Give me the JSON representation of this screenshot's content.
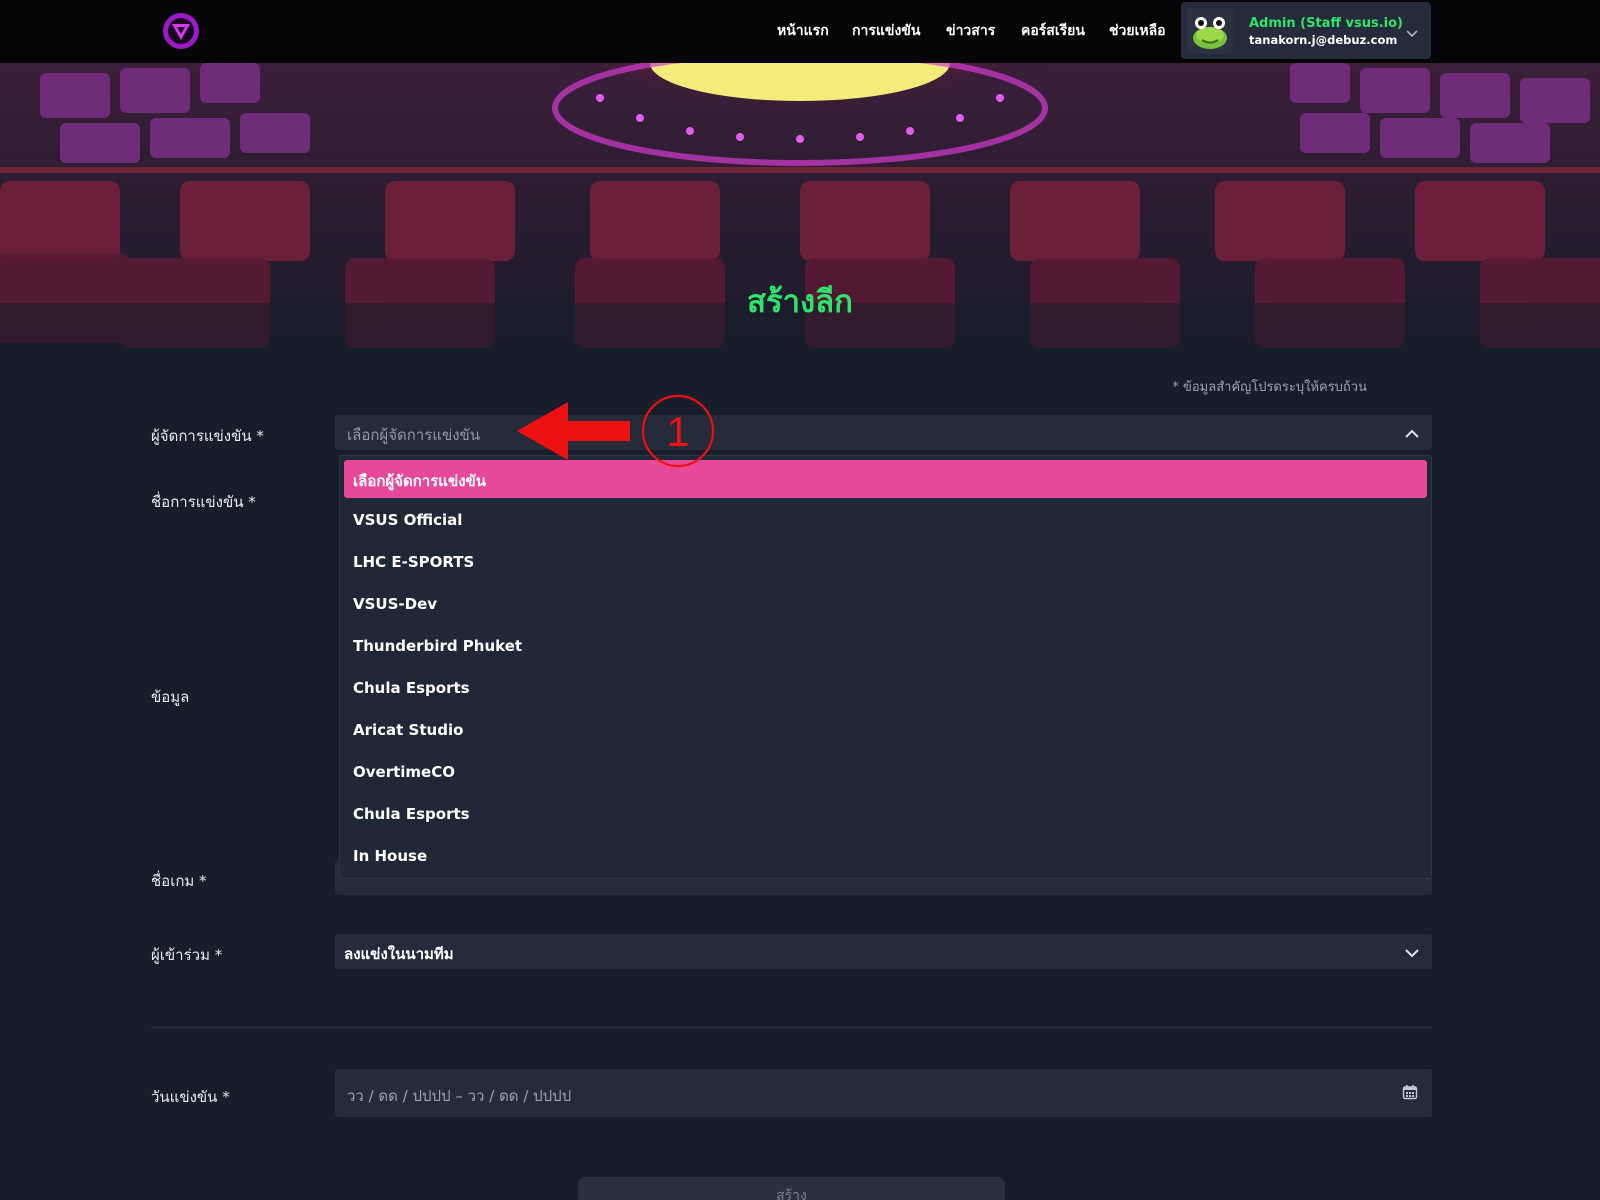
{
  "nav": {
    "items": [
      "หน้าแรก",
      "การแข่งขัน",
      "ข่าวสาร",
      "คอร์สเรียน",
      "ช่วยเหลือ"
    ],
    "user_name": "Admin (Staff vsus.io)",
    "user_email": "tanakorn.j@debuz.com"
  },
  "page": {
    "title": "สร้างลีก"
  },
  "form": {
    "required_note": "* ข้อมูลสำคัญโปรดระบุให้ครบถ้วน",
    "organizer_label": "ผู้จัดการแข่งขัน *",
    "organizer_placeholder": "เลือกผู้จัดการแข่งขัน",
    "competition_name_label": "ชื่อการแข่งขัน *",
    "info_label": "ข้อมูล",
    "game_label": "ชื่อเกม *",
    "participant_label": "ผู้เข้าร่วม *",
    "participant_value": "ลงแข่งในนามทีม",
    "date_label": "วันแข่งขัน *",
    "date_placeholder": "วว / ดด / ปปปป  – วว / ดด / ปปปป",
    "submit_label": "สร้าง"
  },
  "dropdown": {
    "options": [
      "เลือกผู้จัดการแข่งขัน",
      "VSUS Official",
      "LHC E-SPORTS",
      "VSUS-Dev",
      "Thunderbird Phuket",
      "Chula Esports",
      "Aricat Studio",
      "OvertimeCO",
      "Chula Esports",
      "In House"
    ],
    "selected_index": 0
  },
  "annotation": {
    "marker": "1"
  },
  "colors": {
    "accent_green": "#2fe36b",
    "highlight_pink": "#e6489a",
    "annotation_red": "#ee1111",
    "background": "#171d2b",
    "field_bg": "#252b3a"
  },
  "icons": [
    "logo-icon",
    "avatar-frog-icon",
    "chevron-down-icon",
    "chevron-up-icon",
    "calendar-icon",
    "annotation-arrow-icon"
  ]
}
